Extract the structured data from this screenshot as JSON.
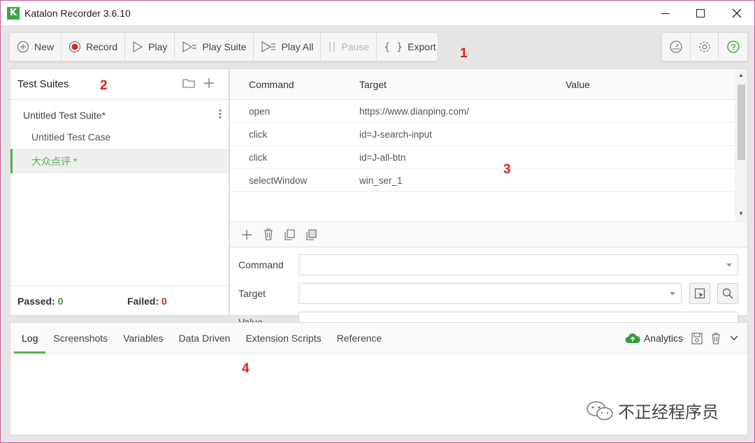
{
  "window": {
    "title": "Katalon Recorder 3.6.10",
    "logo_letter": "K",
    "min_icon": "minimize-icon",
    "max_icon": "maximize-icon",
    "close_icon": "close-icon"
  },
  "toolbar": {
    "new_label": "New",
    "record_label": "Record",
    "play_label": "Play",
    "play_suite_label": "Play Suite",
    "play_all_label": "Play All",
    "pause_label": "Pause",
    "export_label": "Export",
    "right_icons": [
      "speed-icon",
      "gear-icon",
      "help-icon"
    ]
  },
  "markers": {
    "m1": "1",
    "m2": "2",
    "m3": "3",
    "m4": "4"
  },
  "suites": {
    "title": "Test Suites",
    "suite_name": "Untitled Test Suite*",
    "cases": [
      "Untitled Test Case",
      "大众点评 *"
    ],
    "active_index": 1,
    "passed_label": "Passed:",
    "passed_value": "0",
    "failed_label": "Failed:",
    "failed_value": "0"
  },
  "commands": {
    "headers": {
      "command": "Command",
      "target": "Target",
      "value": "Value"
    },
    "rows": [
      {
        "command": "open",
        "target": "https://www.dianping.com/",
        "value": ""
      },
      {
        "command": "click",
        "target": "id=J-search-input",
        "value": ""
      },
      {
        "command": "click",
        "target": "id=J-all-btn",
        "value": ""
      },
      {
        "command": "selectWindow",
        "target": "win_ser_1",
        "value": ""
      }
    ]
  },
  "editor": {
    "command_label": "Command",
    "target_label": "Target",
    "value_label": "Value",
    "command_value": "",
    "target_value": "",
    "value_value": ""
  },
  "bottom": {
    "tabs": [
      "Log",
      "Screenshots",
      "Variables",
      "Data Driven",
      "Extension Scripts",
      "Reference"
    ],
    "active_tab": 0,
    "analytics_label": "Analytics"
  },
  "watermark": {
    "text": "不正经程序员"
  },
  "colors": {
    "accent_green": "#52b14a",
    "record_red": "#e02020",
    "marker_red": "#e02020"
  }
}
